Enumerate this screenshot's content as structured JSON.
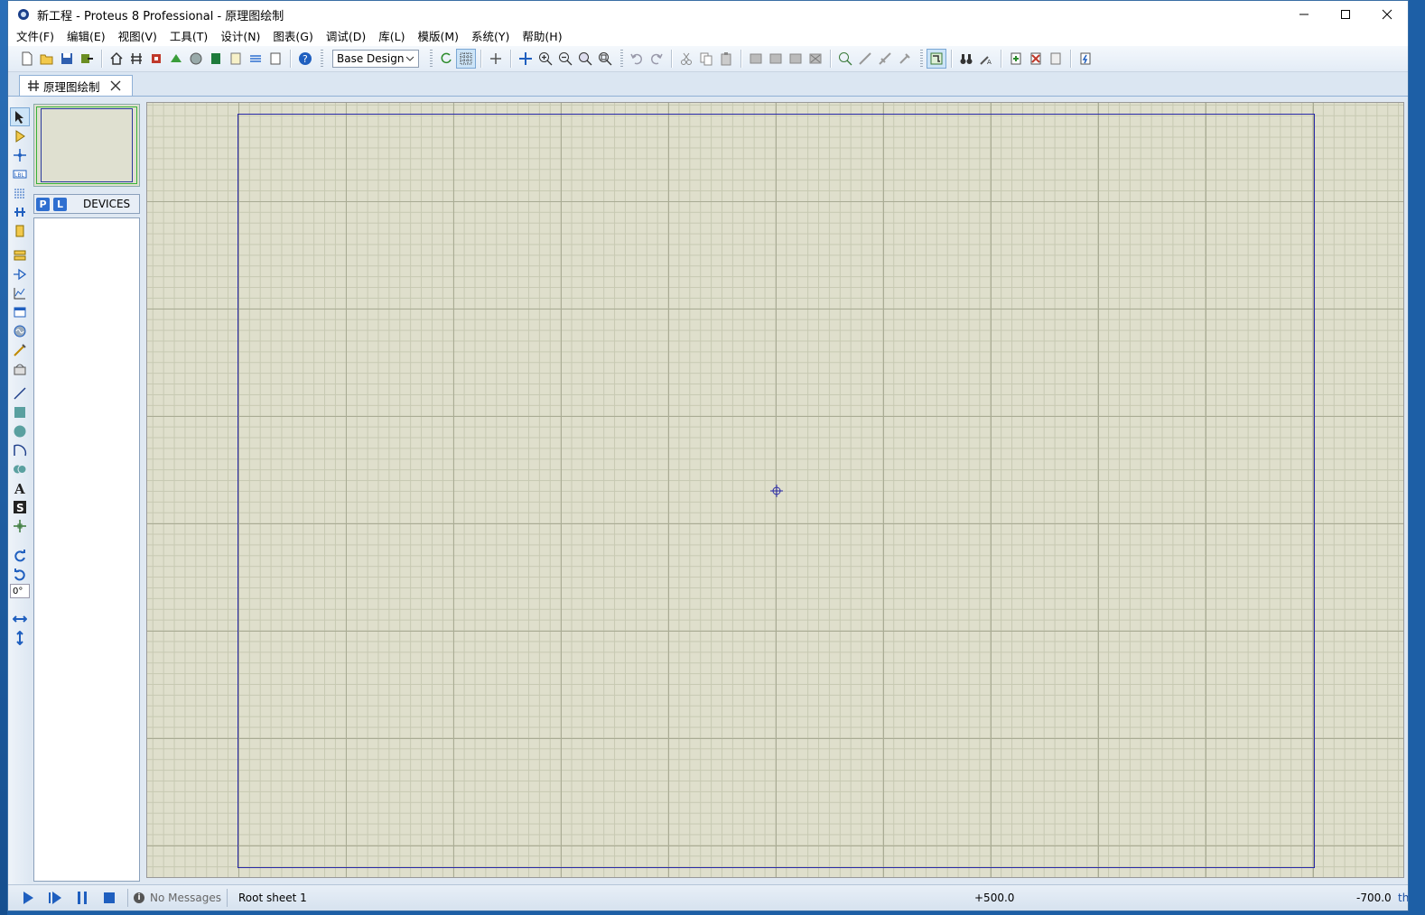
{
  "window": {
    "title": "新工程 - Proteus 8 Professional - 原理图绘制",
    "controls": [
      "minimize-icon",
      "maximize-icon",
      "close-icon"
    ]
  },
  "menu": [
    "文件(F)",
    "编辑(E)",
    "视图(V)",
    "工具(T)",
    "设计(N)",
    "图表(G)",
    "调试(D)",
    "库(L)",
    "模版(M)",
    "系统(Y)",
    "帮助(H)"
  ],
  "toolbar": {
    "design_variant": "Base Design"
  },
  "tab": {
    "label": "原理图绘制"
  },
  "devices": {
    "p_label": "P",
    "l_label": "L",
    "header": "DEVICES",
    "items": []
  },
  "left_tools": {
    "rotation_value": "0°"
  },
  "status": {
    "messages": "No Messages",
    "sheet": "Root sheet 1",
    "x": "+500.0",
    "y": "-700.0",
    "unit": "th"
  },
  "colors": {
    "canvas_bg": "#dfdfcc",
    "sheet_border": "#2a2aa8",
    "accent": "#2f6fd0"
  }
}
